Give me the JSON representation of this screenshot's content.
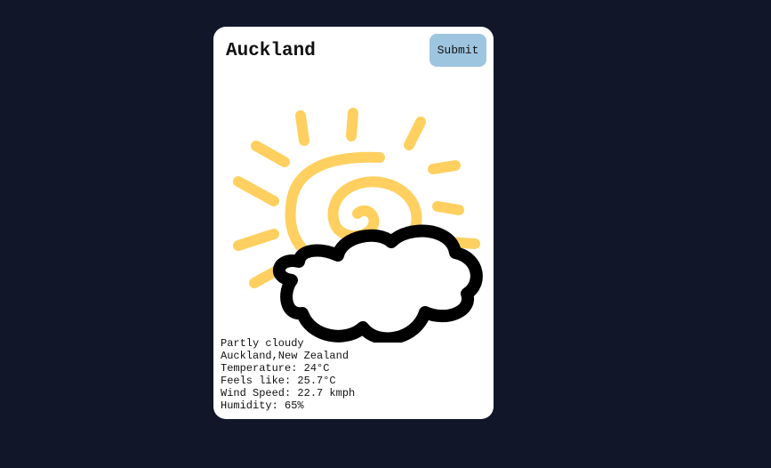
{
  "search": {
    "value": "Auckland",
    "submit_label": "Submit"
  },
  "icon": "partly-cloudy-icon",
  "colors": {
    "background": "#111729",
    "card": "#ffffff",
    "submit": "#9ec5e0",
    "sun": "#ffd060",
    "cloud_outline": "#000000"
  },
  "weather": {
    "condition": "Partly cloudy",
    "location": "Auckland,New Zealand",
    "temperature": "Temperature: 24°C",
    "feels_like": "Feels like: 25.7°C",
    "wind_speed": "Wind Speed: 22.7 kmph",
    "humidity": "Humidity: 65%"
  }
}
